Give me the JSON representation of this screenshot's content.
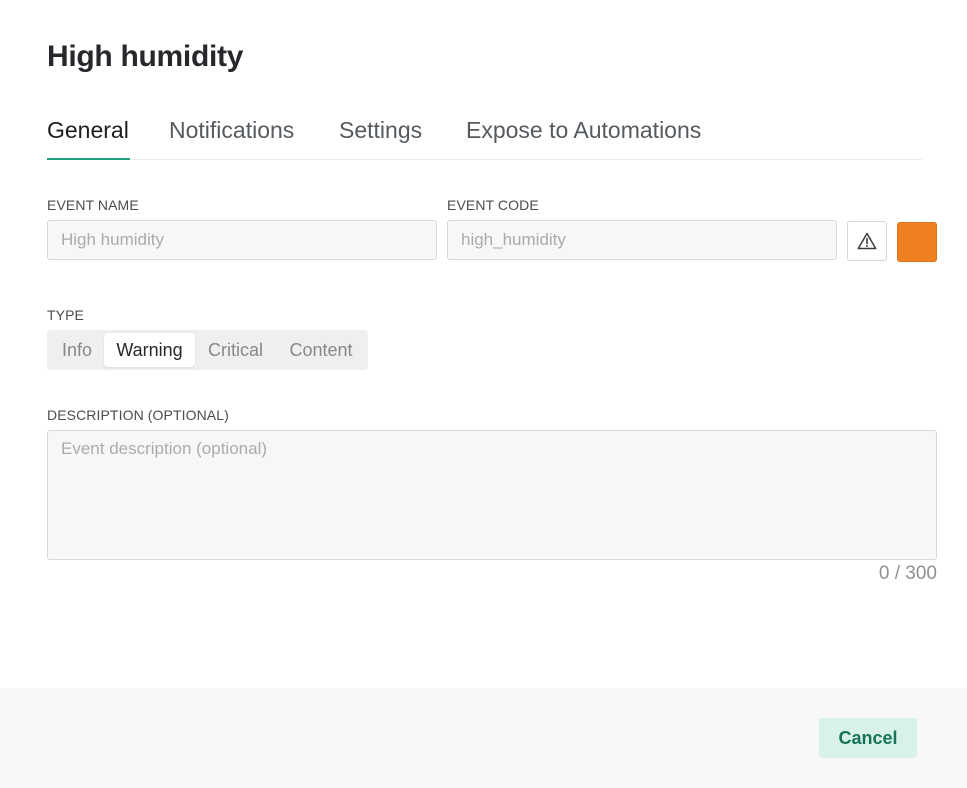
{
  "dialog": {
    "title": "High humidity"
  },
  "tabs": [
    {
      "label": "General",
      "active": true
    },
    {
      "label": "Notifications",
      "active": false
    },
    {
      "label": "Settings",
      "active": false
    },
    {
      "label": "Expose to Automations",
      "active": false
    }
  ],
  "form": {
    "event_name": {
      "label": "EVENT NAME",
      "value": "",
      "placeholder": "High humidity"
    },
    "event_code": {
      "label": "EVENT CODE",
      "value": "",
      "placeholder": "high_humidity"
    },
    "icon_button": {
      "icon": "warning-triangle-icon"
    },
    "color_button": {
      "color": "#ef8022"
    },
    "type": {
      "label": "TYPE",
      "options": [
        "Info",
        "Warning",
        "Critical",
        "Content"
      ],
      "selected": "Warning"
    },
    "description": {
      "label": "DESCRIPTION (OPTIONAL)",
      "value": "",
      "placeholder": "Event description (optional)",
      "counter": "0 / 300"
    }
  },
  "footer": {
    "cancel_label": "Cancel"
  },
  "colors": {
    "accent": "#1fa07c",
    "event_color": "#ef8022",
    "cancel_bg": "#d9f2e8",
    "cancel_text": "#17725a"
  }
}
